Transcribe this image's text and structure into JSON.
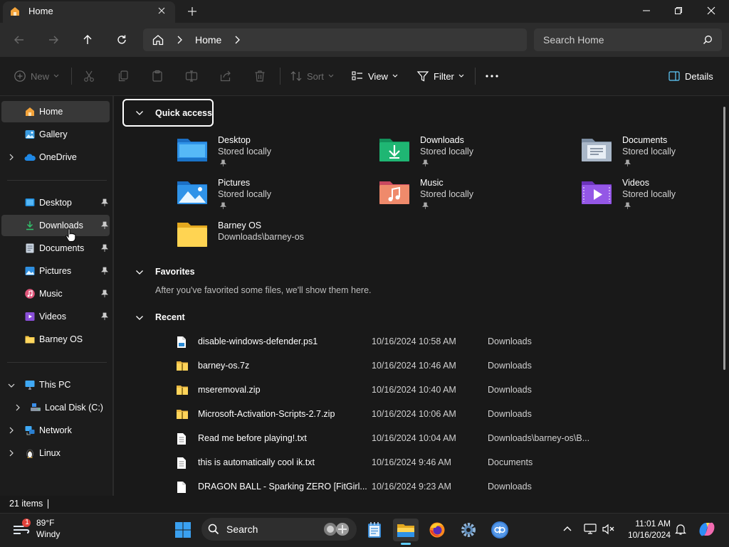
{
  "window": {
    "tab_title": "Home",
    "tab_icon": "home-icon",
    "buttons": [
      "minimize-icon",
      "maximize-icon",
      "close-icon"
    ]
  },
  "address_bar": {
    "breadcrumb": [
      "Home"
    ],
    "search_placeholder": "Search Home"
  },
  "command_bar": {
    "new_label": "New",
    "sort_label": "Sort",
    "view_label": "View",
    "filter_label": "Filter",
    "details_label": "Details",
    "disabled_icons": [
      "cut-icon",
      "copy-icon",
      "paste-icon",
      "rename-icon",
      "share-icon",
      "delete-icon"
    ]
  },
  "sidebar": {
    "top": [
      {
        "label": "Home",
        "icon": "home-icon",
        "selected": true
      },
      {
        "label": "Gallery",
        "icon": "gallery-icon"
      },
      {
        "label": "OneDrive",
        "icon": "onedrive-icon",
        "expandable": true
      }
    ],
    "pinned": [
      {
        "label": "Desktop",
        "icon": "desktop-folder-icon",
        "pinned": true
      },
      {
        "label": "Downloads",
        "icon": "downloads-folder-icon",
        "pinned": true,
        "hover": true
      },
      {
        "label": "Documents",
        "icon": "documents-folder-icon",
        "pinned": true
      },
      {
        "label": "Pictures",
        "icon": "pictures-folder-icon",
        "pinned": true
      },
      {
        "label": "Music",
        "icon": "music-folder-icon",
        "pinned": true
      },
      {
        "label": "Videos",
        "icon": "videos-folder-icon",
        "pinned": true
      },
      {
        "label": "Barney OS",
        "icon": "folder-icon",
        "pinned": false
      }
    ],
    "tree": [
      {
        "label": "This PC",
        "icon": "this-pc-icon",
        "expanded": true,
        "indent": 0
      },
      {
        "label": "Local Disk (C:)",
        "icon": "disk-icon",
        "expanded": false,
        "indent": 1
      },
      {
        "label": "Network",
        "icon": "network-icon",
        "expanded": false,
        "indent": 0
      },
      {
        "label": "Linux",
        "icon": "linux-icon",
        "expanded": false,
        "indent": 0
      }
    ]
  },
  "quick_access": {
    "title": "Quick access",
    "items": [
      {
        "name": "Desktop",
        "sub": "Stored locally",
        "icon": "desktop-folder-icon",
        "pinned": true
      },
      {
        "name": "Downloads",
        "sub": "Stored locally",
        "icon": "downloads-folder-icon",
        "pinned": true
      },
      {
        "name": "Documents",
        "sub": "Stored locally",
        "icon": "documents-folder-icon",
        "pinned": true
      },
      {
        "name": "Pictures",
        "sub": "Stored locally",
        "icon": "pictures-folder-icon",
        "pinned": true
      },
      {
        "name": "Music",
        "sub": "Stored locally",
        "icon": "music-folder-icon",
        "pinned": true
      },
      {
        "name": "Videos",
        "sub": "Stored locally",
        "icon": "videos-folder-icon",
        "pinned": true
      },
      {
        "name": "Barney OS",
        "sub": "Downloads\\barney-os",
        "icon": "folder-icon",
        "pinned": false
      }
    ]
  },
  "favorites": {
    "title": "Favorites",
    "empty_text": "After you've favorited some files, we'll show them here."
  },
  "recent": {
    "title": "Recent",
    "items": [
      {
        "name": "disable-windows-defender.ps1",
        "date": "10/16/2024 10:58 AM",
        "location": "Downloads",
        "icon": "script-file-icon"
      },
      {
        "name": "barney-os.7z",
        "date": "10/16/2024 10:46 AM",
        "location": "Downloads",
        "icon": "archive-icon"
      },
      {
        "name": "mseremoval.zip",
        "date": "10/16/2024 10:40 AM",
        "location": "Downloads",
        "icon": "archive-icon"
      },
      {
        "name": "Microsoft-Activation-Scripts-2.7.zip",
        "date": "10/16/2024 10:06 AM",
        "location": "Downloads",
        "icon": "archive-icon"
      },
      {
        "name": "Read me before playing!.txt",
        "date": "10/16/2024 10:04 AM",
        "location": "Downloads\\barney-os\\B...",
        "icon": "text-file-icon"
      },
      {
        "name": "this is automatically cool ik.txt",
        "date": "10/16/2024 9:46 AM",
        "location": "Documents",
        "icon": "text-file-icon"
      },
      {
        "name": "DRAGON BALL - Sparking ZERO [FitGirl...",
        "date": "10/16/2024 9:23 AM",
        "location": "Downloads",
        "icon": "file-icon"
      }
    ]
  },
  "status": {
    "item_count": "21 items"
  },
  "taskbar": {
    "weather_temp": "89°F",
    "weather_desc": "Windy",
    "weather_badge": "1",
    "search_label": "Search",
    "time": "11:01 AM",
    "date": "10/16/2024",
    "apps": [
      "start-icon",
      "notepad-icon",
      "file-explorer-icon",
      "firefox-icon",
      "settings-icon",
      "qbittorrent-icon"
    ]
  },
  "colors": {
    "background": "#191919",
    "sidebar_selected": "#383838",
    "accent_blue": "#0078d4"
  }
}
